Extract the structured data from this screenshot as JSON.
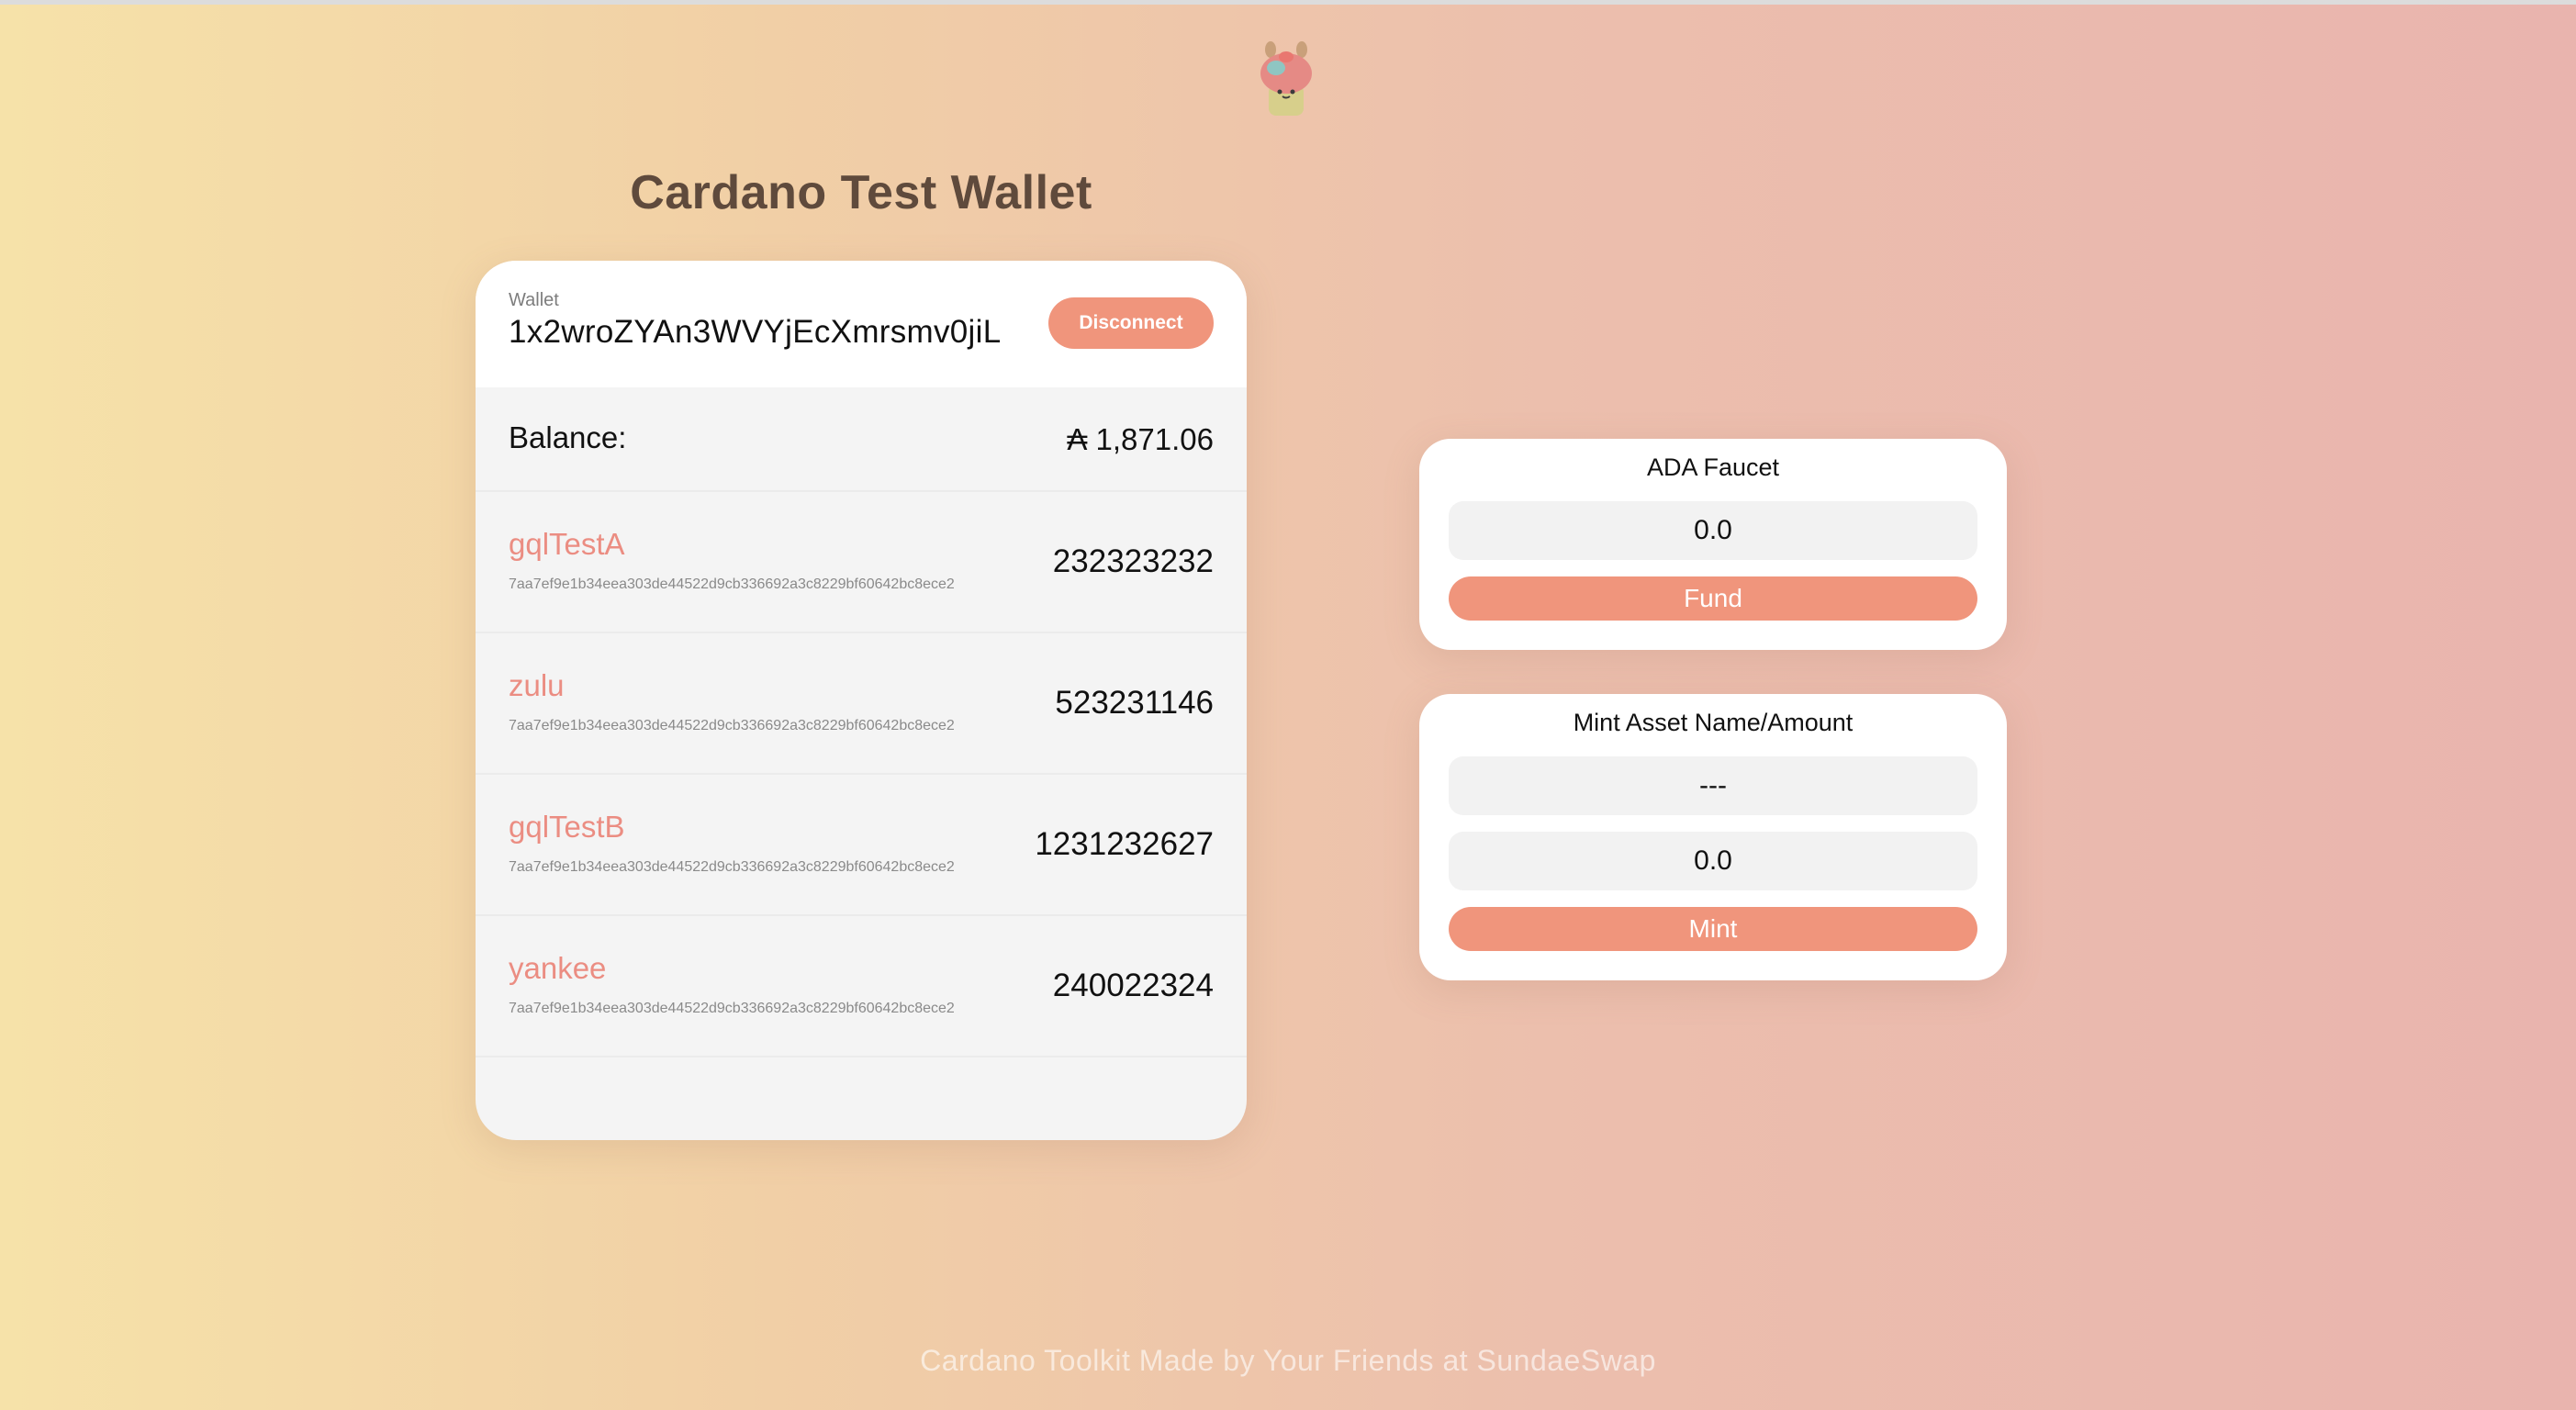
{
  "header": {
    "title": "Cardano Test Wallet"
  },
  "wallet": {
    "label": "Wallet",
    "address": "1x2wroZYAn3WVYjEcXmrsmv0jiL",
    "disconnect_label": "Disconnect",
    "balance_label": "Balance:",
    "balance_value": "₳ 1,871.06",
    "assets": [
      {
        "name": "gqlTestA",
        "policy": "7aa7ef9e1b34eea303de44522d9cb336692a3c8229bf60642bc8ece2",
        "amount": "232323232"
      },
      {
        "name": "zulu",
        "policy": "7aa7ef9e1b34eea303de44522d9cb336692a3c8229bf60642bc8ece2",
        "amount": "523231146"
      },
      {
        "name": "gqlTestB",
        "policy": "7aa7ef9e1b34eea303de44522d9cb336692a3c8229bf60642bc8ece2",
        "amount": "1231232627"
      },
      {
        "name": "yankee",
        "policy": "7aa7ef9e1b34eea303de44522d9cb336692a3c8229bf60642bc8ece2",
        "amount": "240022324"
      }
    ]
  },
  "faucet": {
    "title": "ADA Faucet",
    "amount_value": "0.0",
    "fund_label": "Fund"
  },
  "mint": {
    "title": "Mint Asset Name/Amount",
    "name_value": "---",
    "amount_value": "0.0",
    "mint_label": "Mint"
  },
  "footer": {
    "text": "Cardano Toolkit Made by Your Friends at SundaeSwap"
  },
  "colors": {
    "accent": "#f0957c",
    "asset_name": "#eb8d82",
    "title": "#5f4a3c"
  },
  "icons": {
    "logo": "sundae-mascot-icon"
  }
}
